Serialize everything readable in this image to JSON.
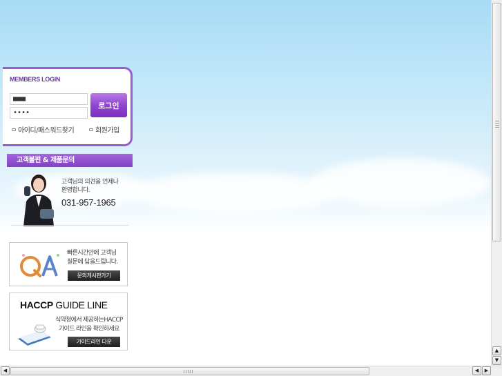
{
  "login": {
    "title": "MEMBERS LOGIN",
    "id_value": "■■■",
    "password_value": "••••",
    "login_button": "로그인",
    "find_link": "아이디/패스워드찾기",
    "join_link": "회원가입"
  },
  "customer_service": {
    "header": "고객불편 & 제품문의",
    "message_line1": "고객님의 의견을 언제나",
    "message_line2": "환영합니다.",
    "phone": "031-957-1965"
  },
  "qa": {
    "text_line1": "빠른시간안에 고객님",
    "text_line2": "질문에 답을드립니다.",
    "button": "문의게시판가기"
  },
  "haccp": {
    "title_bold": "HACCP",
    "title_rest": " GUIDE LINE",
    "text_line1": "식약청에서 제공하는HACCP",
    "text_line2": "가이드 라인을 확인하세요",
    "button": "가이드라인 다운"
  },
  "colors": {
    "accent": "#8b45c8",
    "sky": "#a7dbf5"
  },
  "icons": {
    "scroll_up": "▲",
    "scroll_down": "▼",
    "scroll_left": "◀",
    "scroll_right": "▶"
  }
}
